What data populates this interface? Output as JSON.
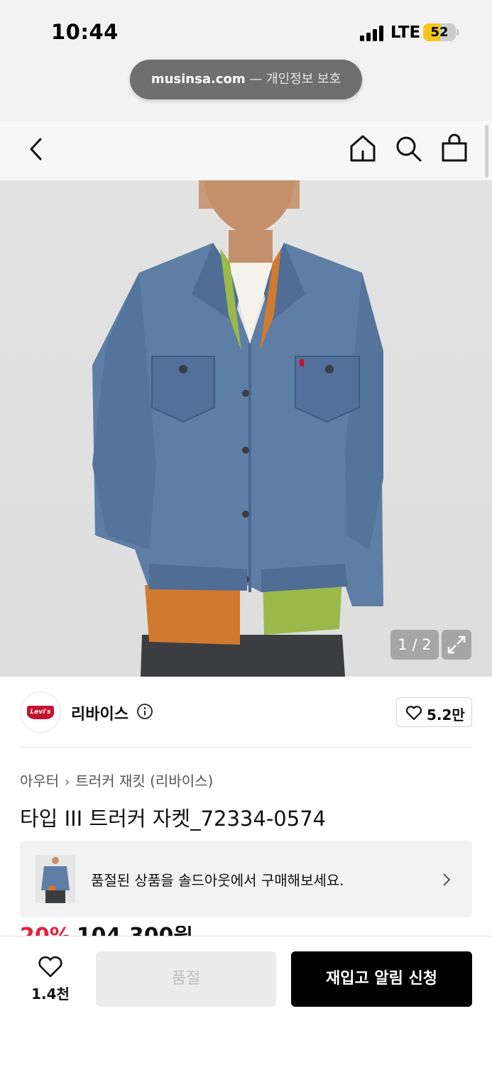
{
  "status_bar": {
    "time": "10:44",
    "network": "LTE",
    "battery": "52",
    "battery_level": 0.52
  },
  "browser": {
    "domain": "musinsa.com",
    "separator": " — ",
    "privacy_label": "개인정보 보호"
  },
  "nav": {
    "icons": [
      "back-chevron-icon",
      "home-icon",
      "search-icon",
      "shopping-bag-icon"
    ]
  },
  "gallery": {
    "counter": "1 / 2",
    "icons": [
      "expand-icon"
    ]
  },
  "brand": {
    "logo_text": "Levi's",
    "name": "리바이스",
    "like_count": "5.2만",
    "colors": {
      "logo_red": "#c41230"
    }
  },
  "breadcrumb": {
    "items": [
      "아우터",
      "트러커 재킷 (리바이스)"
    ]
  },
  "product": {
    "title": "타입 III 트러커 자켓_72334-0574",
    "discount": "20%",
    "price": "104,300원"
  },
  "soldout_banner": {
    "text": "품절된 상품을 솔드아웃에서 구매해보세요."
  },
  "bottom_bar": {
    "wish_count": "1.4천",
    "soldout_label": "품절",
    "restock_label": "재입고 알림 신청",
    "colors": {
      "discount_red": "#e0243b",
      "primary": "#000000"
    }
  }
}
